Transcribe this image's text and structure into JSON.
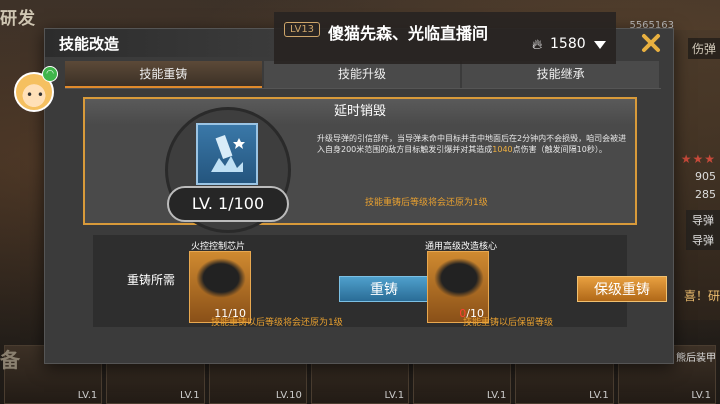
{
  "background": {
    "title": "研发",
    "right_tag": "伤弹",
    "right_numbers": [
      "905",
      "285"
    ],
    "right_buttons": [
      "导弹",
      "导弹"
    ],
    "right_congrats": "喜！研",
    "top_right_number": "5565163",
    "bottom_left_tag": "备",
    "bottom_right_text": "熊后装甲",
    "bottom_cards": [
      "LV.1",
      "LV.1",
      "LV.10",
      "LV.1",
      "LV.1",
      "LV.1",
      "LV.1"
    ]
  },
  "stream": {
    "level": "LV13",
    "title": "傻猫先森、光临直播间",
    "coins": "1580"
  },
  "dialog": {
    "title": "技能改造",
    "tabs": [
      "技能重铸",
      "技能升级",
      "技能继承"
    ],
    "active_tab": 0,
    "skill": {
      "name": "延时销毁",
      "desc_part1": "升级导弹的引信部件，当导弹未命中目标并击中地面后在2分钟内不会损毁，咱司会被进入自身200米范围的敌方目标触发引爆并对其造成",
      "desc_highlight": "1040",
      "desc_part2": "点伤害（触发间隔10秒）。",
      "level": "LV. 1/100",
      "warning": "技能重铸后等级将会还原为1级"
    },
    "cost": {
      "label": "重铸所需",
      "items": [
        {
          "name": "火控控制芯片",
          "have": "11",
          "need": "/10",
          "button": "重铸",
          "note": "技能重铸以后等级将会还原为1级"
        },
        {
          "name": "通用高级改造核心",
          "have": "0",
          "need": "/10",
          "button": "保级重铸",
          "note": "技能重铸以后保留等级"
        }
      ]
    }
  },
  "colors": {
    "accent_orange": "#e08a2c",
    "recast_blue": "#3a86b4",
    "warning_text": "#e8a030"
  }
}
